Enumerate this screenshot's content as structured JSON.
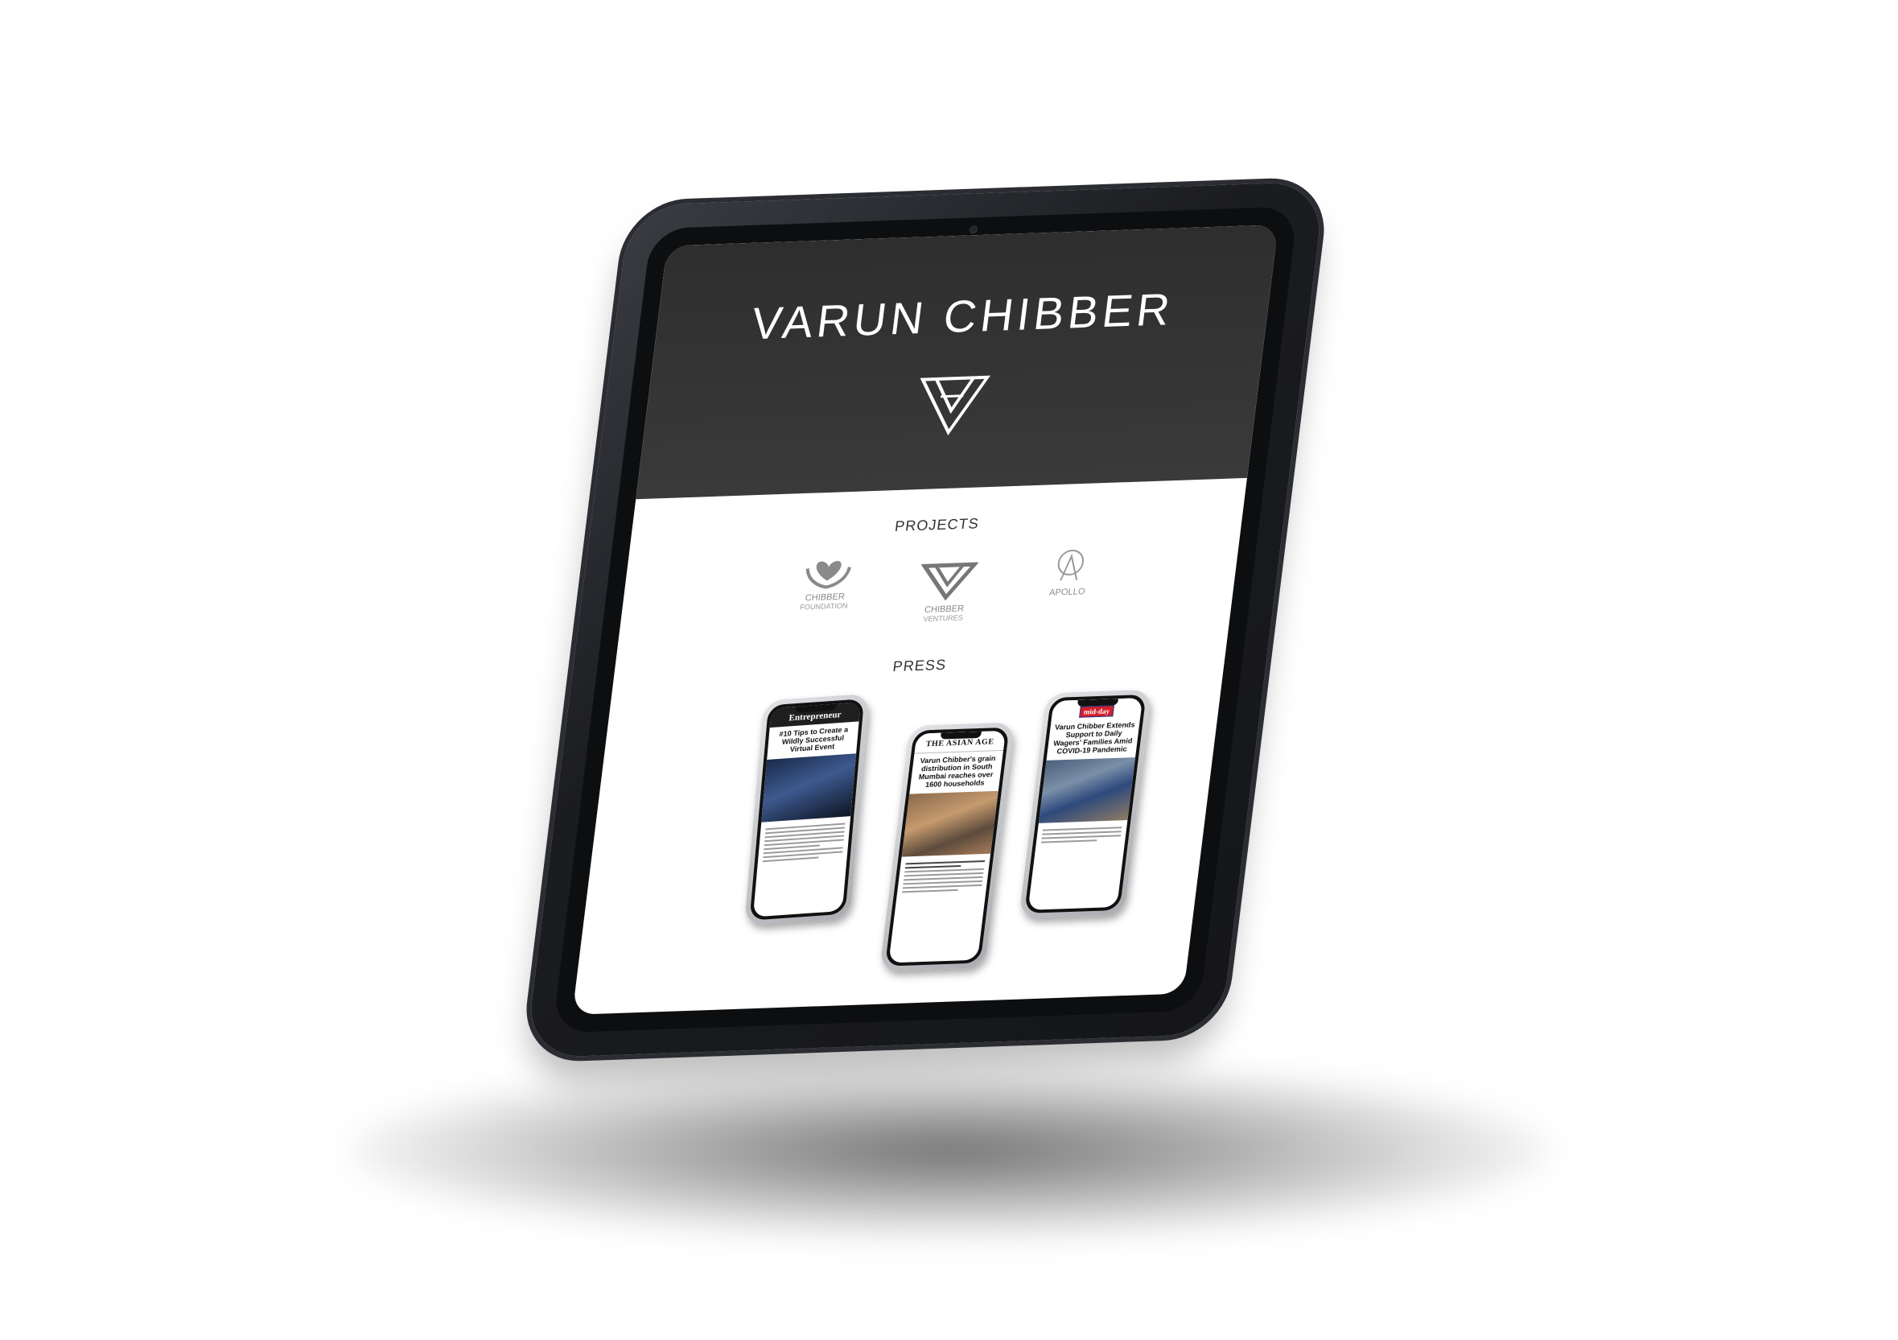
{
  "hero": {
    "title": "VARUN CHIBBER"
  },
  "sections": {
    "projects_title": "PROJECTS",
    "press_title": "PRESS"
  },
  "projects": [
    {
      "name": "CHIBBER",
      "subtitle": "FOUNDATION",
      "icon": "hands-heart-icon"
    },
    {
      "name": "CHIBBER",
      "subtitle": "VENTURES",
      "icon": "triangle-v-icon"
    },
    {
      "name": "APOLLO",
      "subtitle": "",
      "icon": "circle-a-icon"
    }
  ],
  "press": [
    {
      "masthead": "Entrepreneur",
      "headline": "#10 Tips to Create a Wildly Successful Virtual Event"
    },
    {
      "masthead": "THE ASIAN AGE",
      "headline": "Varun Chibber's grain distribution in South Mumbai reaches over 1600 households"
    },
    {
      "masthead": "mid-day",
      "headline": "Varun Chibber Extends Support to Daily Wagers' Families Amid COVID-19 Pandemic"
    }
  ],
  "colors": {
    "hero_bg": "#333333",
    "screen_bg": "#ffffff",
    "device_frame": "#1b1c20",
    "midday_red": "#d21f2b"
  }
}
